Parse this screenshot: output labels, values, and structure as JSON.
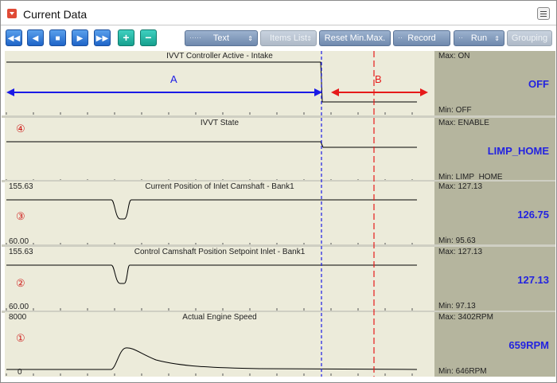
{
  "window": {
    "title": "Current Data"
  },
  "toolbar": {
    "text_label": "Text",
    "items_list_label": "Items List",
    "reset_label": "Reset Min.Max.",
    "record_label": "Record",
    "run_label": "Run",
    "grouping_label": "Grouping"
  },
  "rows": [
    {
      "title": "IVVT Controller Active - Intake",
      "axis_max": "",
      "axis_min": "",
      "info_max": "Max: ON",
      "info_min": "Min: OFF",
      "value": "OFF",
      "marker": "",
      "annotations": {
        "a": "A",
        "b": "B"
      }
    },
    {
      "title": "IVVT State",
      "axis_max": "",
      "axis_min": "",
      "info_max": "Max: ENABLE",
      "info_min": "Min: LIMP_HOME",
      "value": "LIMP_HOME",
      "marker": "④"
    },
    {
      "title": "Current Position of Inlet Camshaft - Bank1",
      "axis_max": "155.63",
      "axis_min": "60.00",
      "info_max": "Max: 127.13",
      "info_min": "Min: 95.63",
      "value": "126.75",
      "marker": "③"
    },
    {
      "title": "Control Camshaft Position Setpoint Inlet - Bank1",
      "axis_max": "155.63",
      "axis_min": "60.00",
      "info_max": "Max: 127.13",
      "info_min": "Min: 97.13",
      "value": "127.13",
      "marker": "②"
    },
    {
      "title": "Actual Engine Speed",
      "axis_max": "8000",
      "axis_min": "0",
      "info_max": "Max:  3402RPM",
      "info_min": "Min:   646RPM",
      "value": "659RPM",
      "marker": "①"
    }
  ],
  "colors": {
    "graph_bg": "#ecebda",
    "info_bg": "#b5b59e",
    "value": "#2323e0",
    "marker": "#d0201e",
    "arrow_a": "#1a1ae6",
    "arrow_b": "#e61a1a"
  }
}
